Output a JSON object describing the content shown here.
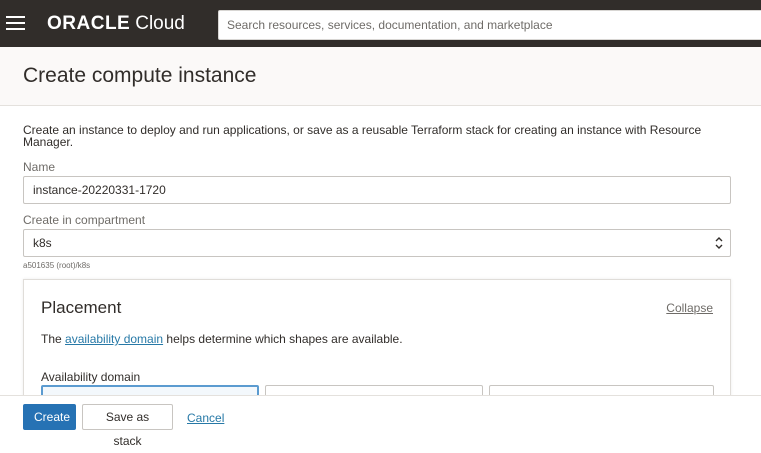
{
  "header": {
    "brand": "ORACLE",
    "product": "Cloud",
    "search_placeholder": "Search resources, services, documentation, and marketplace"
  },
  "page": {
    "title": "Create compute instance"
  },
  "form": {
    "intro": "Create an instance to deploy and run applications, or save as a reusable Terraform stack for creating an instance with Resource Manager.",
    "name_label": "Name",
    "name_value": "instance-20220331-1720",
    "compartment_label": "Create in compartment",
    "compartment_value": "k8s",
    "compartment_path": "a501635 (root)/k8s"
  },
  "placement": {
    "title": "Placement",
    "collapse_label": "Collapse",
    "desc_prefix": "The ",
    "desc_link": "availability domain",
    "desc_suffix": " helps determine which shapes are available.",
    "availability_domain_label": "Availability domain"
  },
  "footer": {
    "create_label": "Create",
    "save_stack_label": "Save as stack",
    "cancel_label": "Cancel"
  },
  "colors": {
    "topbar": "#312d2a",
    "primary": "#2672b4",
    "link": "#2779a7"
  }
}
